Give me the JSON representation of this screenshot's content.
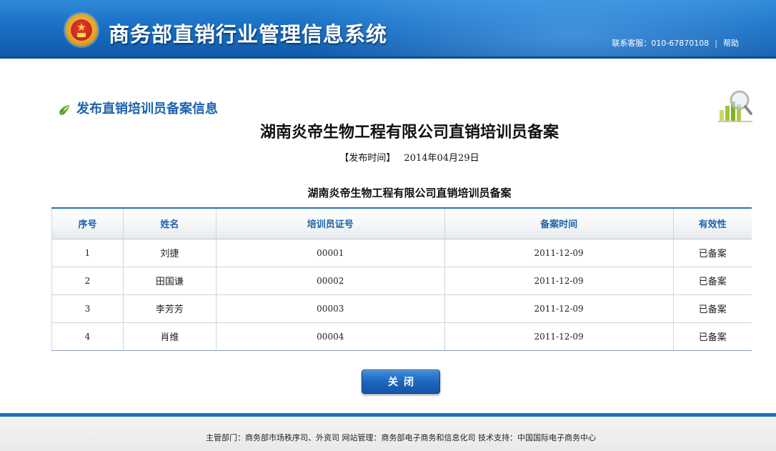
{
  "header": {
    "site_title": "商务部直销行业管理信息系统",
    "service_label": "联系客服：010-67870108",
    "separator": "|",
    "help_label": "帮助"
  },
  "section": {
    "title": "发布直销培训员备案信息"
  },
  "document": {
    "title": "湖南炎帝生物工程有限公司直销培训员备案",
    "date_label": "【发布时间】",
    "date_value": "2014年04月29日",
    "table_caption": "湖南炎帝生物工程有限公司直销培训员备案"
  },
  "table": {
    "columns": [
      "序号",
      "姓名",
      "培训员证号",
      "备案时间",
      "有效性"
    ],
    "rows": [
      [
        "1",
        "刘捷",
        "00001",
        "2011-12-09",
        "已备案"
      ],
      [
        "2",
        "田国谦",
        "00002",
        "2011-12-09",
        "已备案"
      ],
      [
        "3",
        "李芳芳",
        "00003",
        "2011-12-09",
        "已备案"
      ],
      [
        "4",
        "肖维",
        "00004",
        "2011-12-09",
        "已备案"
      ]
    ]
  },
  "close_label": "关闭",
  "footer": {
    "text": "主管部门：商务部市场秩序司、外资司  网站管理：商务部电子商务和信息化司  技术支持：中国国际电子商务中心"
  },
  "colors": {
    "header_blue": "#1a6fc4",
    "accent_blue": "#1d62ad",
    "button_blue": "#1e66bd"
  },
  "icons": {
    "emblem": "national-emblem-icon",
    "leaf": "leaf-bullet-icon",
    "chart": "bar-chart-magnifier-icon"
  }
}
